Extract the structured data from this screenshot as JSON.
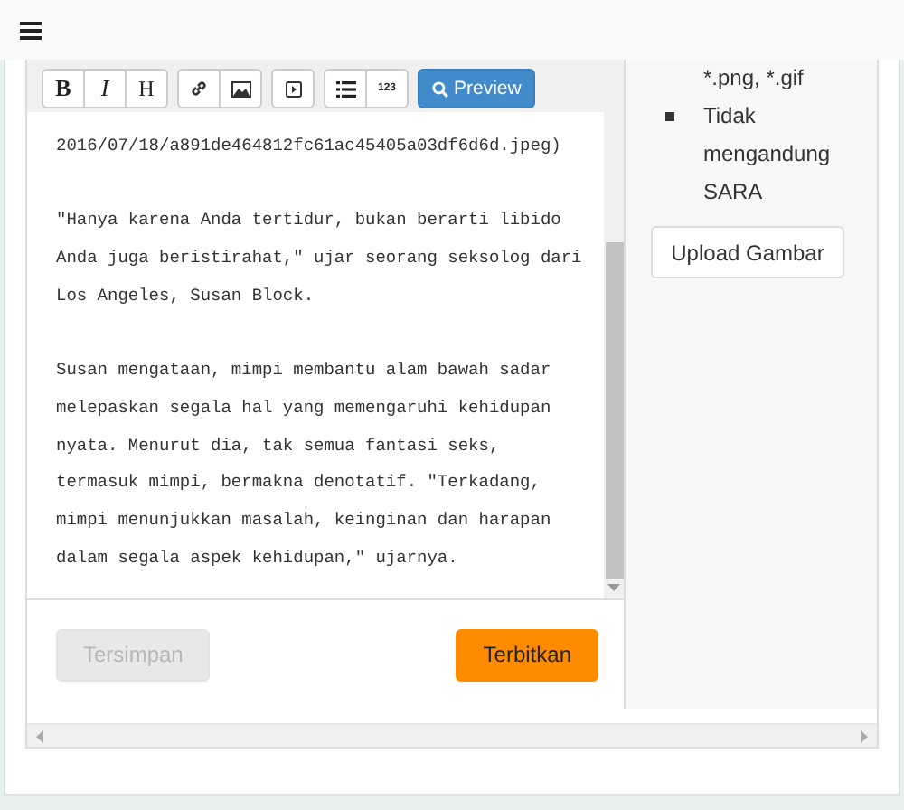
{
  "toolbar": {
    "groups": [
      [
        {
          "kind": "bold",
          "label": "B"
        },
        {
          "kind": "italic",
          "label": "I"
        },
        {
          "kind": "heading",
          "label": "H"
        }
      ],
      [
        {
          "kind": "link"
        },
        {
          "kind": "image"
        }
      ],
      [
        {
          "kind": "media"
        }
      ],
      [
        {
          "kind": "list"
        },
        {
          "kind": "small",
          "label": "123"
        }
      ]
    ],
    "preview": "Preview"
  },
  "editor": {
    "paragraphs": [
      "2016/07/18/a891de464812fc61ac45405a03df6d6d.jpeg)",
      "\"Hanya karena Anda tertidur, bukan berarti libido Anda juga beristirahat,\" ujar seorang seksolog dari Los Angeles, Susan Block.",
      "Susan mengataan, mimpi membantu alam bawah sadar melepaskan segala hal yang memengaruhi kehidupan nyata. Menurut dia, tak semua fantasi seks, termasuk mimpi, bermakna denotatif. \"Terkadang, mimpi menunjukkan masalah, keinginan dan harapan dalam segala aspek kehidupan,\" ujarnya."
    ]
  },
  "actions": [
    {
      "kind": "secondary",
      "label": "Tersimpan",
      "disabled": true
    },
    {
      "kind": "primary",
      "label": "Terbitkan",
      "disabled": false
    }
  ],
  "sidebar": {
    "rules": [
      {
        "text": "*.png, *.gif",
        "bullet": false
      },
      {
        "text": "Tidak mengandung SARA",
        "bullet": true
      }
    ],
    "upload_button": "Upload Gambar"
  }
}
